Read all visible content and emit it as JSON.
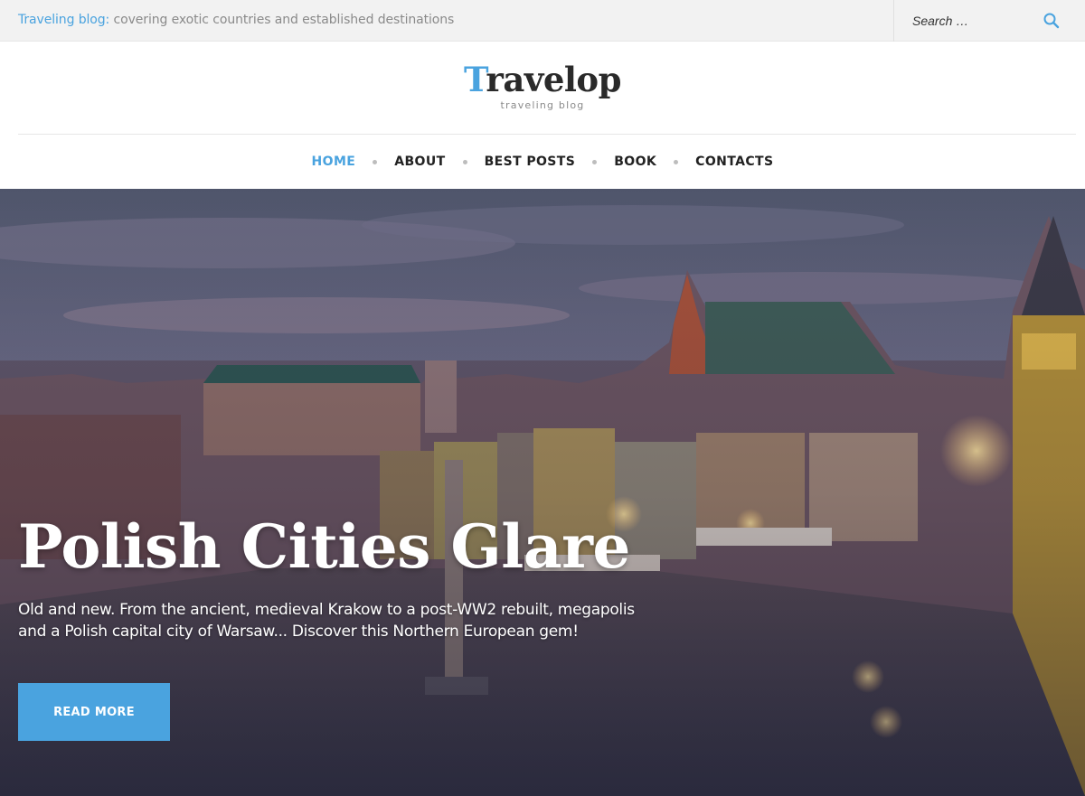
{
  "topbar": {
    "tagline_highlight": "Traveling blog:",
    "tagline_rest": " covering exotic countries and established destinations",
    "search_placeholder": "Search …",
    "search_icon": "search-icon"
  },
  "logo": {
    "first_letter": "T",
    "rest": "ravelop",
    "subtitle": "traveling blog"
  },
  "nav": {
    "items": [
      {
        "label": "HOME",
        "active": true
      },
      {
        "label": "ABOUT",
        "active": false
      },
      {
        "label": "BEST POSTS",
        "active": false
      },
      {
        "label": "BOOK",
        "active": false
      },
      {
        "label": "CONTACTS",
        "active": false
      }
    ]
  },
  "hero": {
    "title": "Polish Cities Glare",
    "text": "Old and new. From the ancient, medieval Krakow to a post-WW2 rebuilt, megapolis and a Polish capital city of Warsaw... Discover this Northern European gem!",
    "button_label": "READ MORE",
    "image_description_icon": "city-photo"
  },
  "colors": {
    "accent": "#4aa3df",
    "text_dark": "#222222",
    "topbar_bg": "#f2f2f2"
  }
}
